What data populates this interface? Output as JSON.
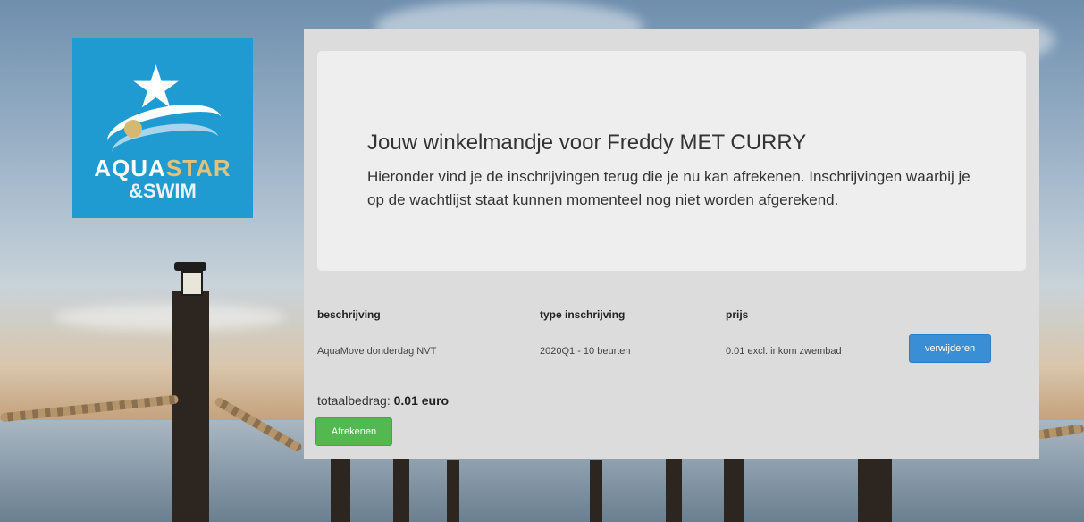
{
  "logo": {
    "line1_a": "AQUA",
    "line1_b": "STAR",
    "line2": "&SWIM"
  },
  "cart": {
    "title": "Jouw winkelmandje voor Freddy MET CURRY",
    "intro": "Hieronder vind je de inschrijvingen terug die je nu kan afrekenen. Inschrijvingen waarbij je op de wachtlijst staat kunnen momenteel nog niet worden afgerekend."
  },
  "table": {
    "headers": [
      "beschrijving",
      "type inschrijving",
      "prijs"
    ],
    "rows": [
      {
        "description": "AquaMove donderdag NVT",
        "type": "2020Q1 - 10 beurten",
        "price": "0.01 excl. inkom zwembad",
        "action": "verwijderen"
      }
    ]
  },
  "total": {
    "label": "totaalbedrag:",
    "value": "0.01 euro"
  },
  "checkout_label": "Afrekenen",
  "colors": {
    "logo_bg": "#1f9bd1",
    "delete_button": "#3a8ed6",
    "checkout_button": "#52b84f"
  }
}
